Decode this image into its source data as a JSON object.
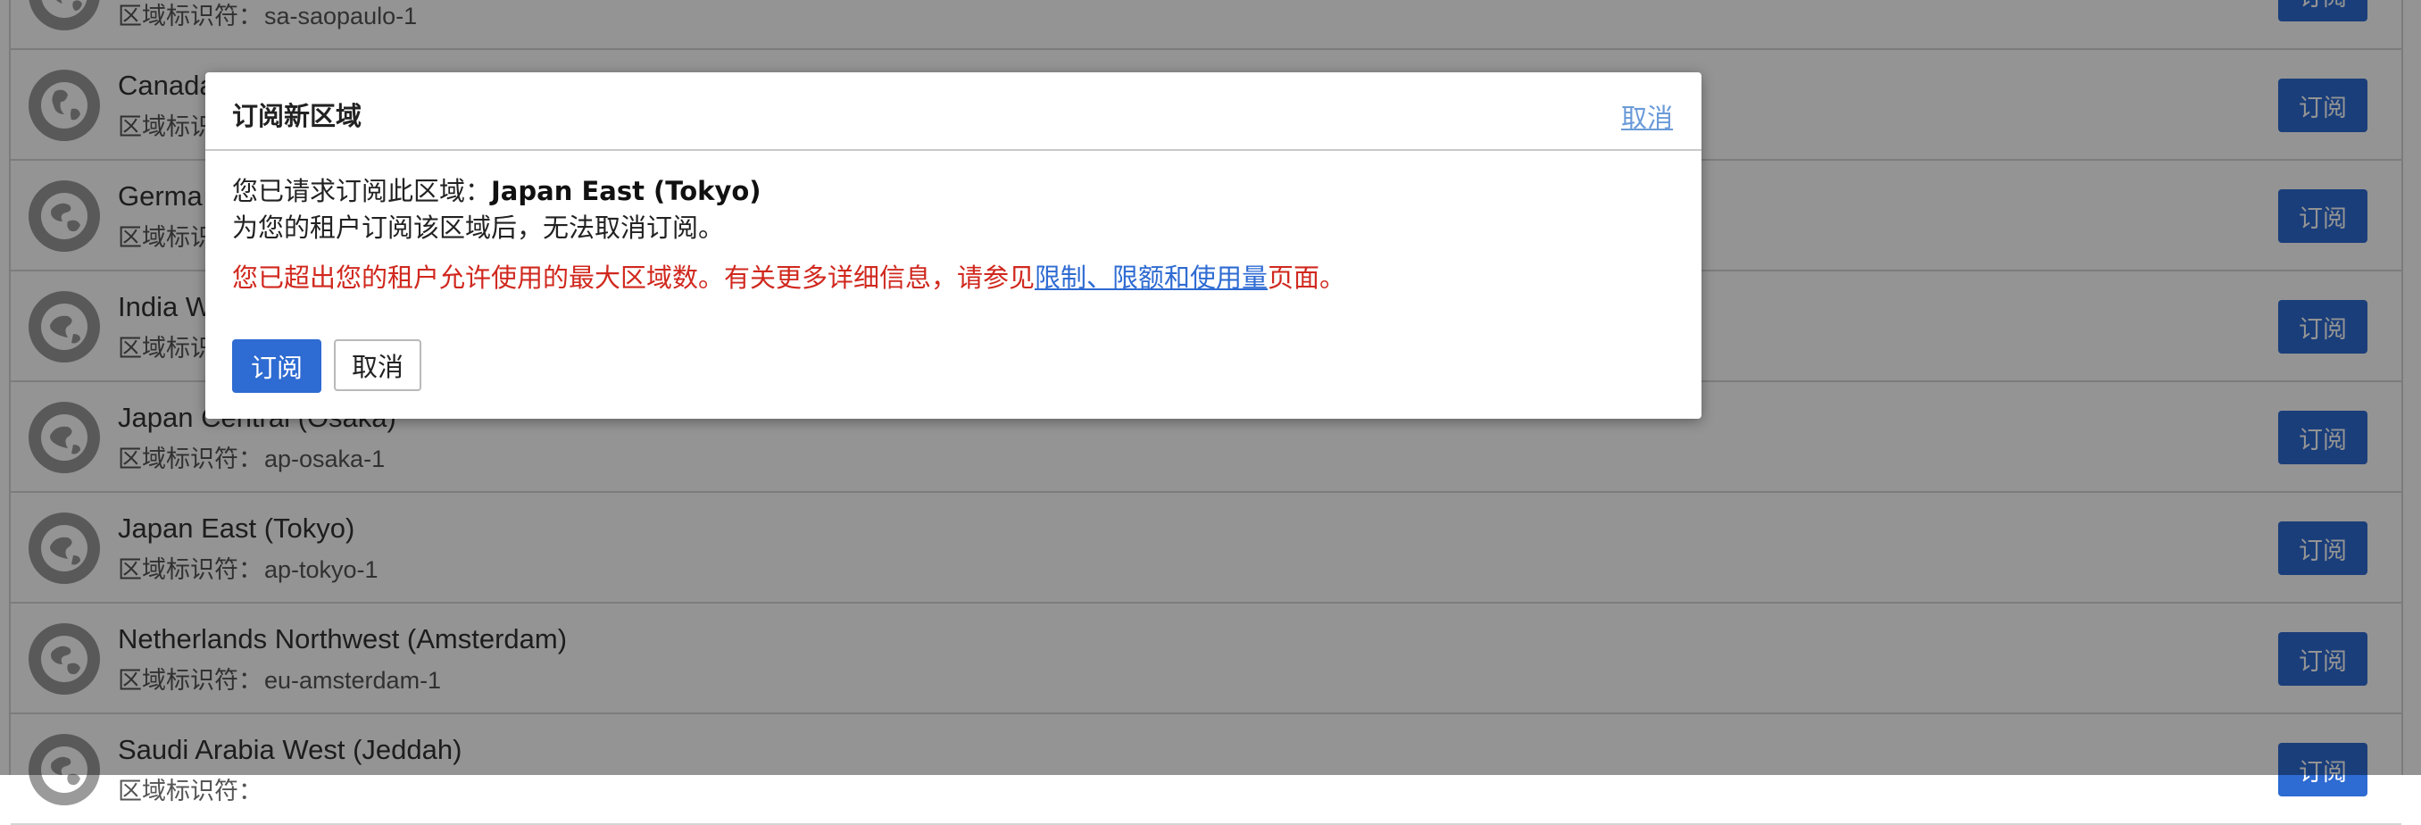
{
  "region_list": {
    "id_prefix": "区域标识符：",
    "subscribe_label": "订阅",
    "rows": [
      {
        "name": "",
        "id": "sa-saopaulo-1"
      },
      {
        "name": "Canada",
        "id": ""
      },
      {
        "name": "Germa",
        "id": ""
      },
      {
        "name": "India W",
        "id": ""
      },
      {
        "name": "Japan Central (Osaka)",
        "id": "ap-osaka-1"
      },
      {
        "name": "Japan East (Tokyo)",
        "id": "ap-tokyo-1"
      },
      {
        "name": "Netherlands Northwest (Amsterdam)",
        "id": "eu-amsterdam-1"
      },
      {
        "name": "Saudi Arabia West (Jeddah)",
        "id": ""
      }
    ]
  },
  "dialog": {
    "title": "订阅新区域",
    "close_label": "取消",
    "request_prefix": "您已请求订阅此区域：",
    "region_name": "Japan East (Tokyo)",
    "irreversible_note": "为您的租户订阅该区域后，无法取消订阅。",
    "limit_error_prefix": "您已超出您的租户允许使用的最大区域数。有关更多详细信息，请参见",
    "limit_link_text": "限制、限额和使用量",
    "limit_error_suffix": "页面。",
    "subscribe_button": "订阅",
    "cancel_button": "取消"
  },
  "colors": {
    "primary": "#2e6bd2",
    "error": "#d0281e",
    "overlay": "rgba(0,0,0,0.42)"
  },
  "icons": {
    "region": "globe-icon"
  }
}
